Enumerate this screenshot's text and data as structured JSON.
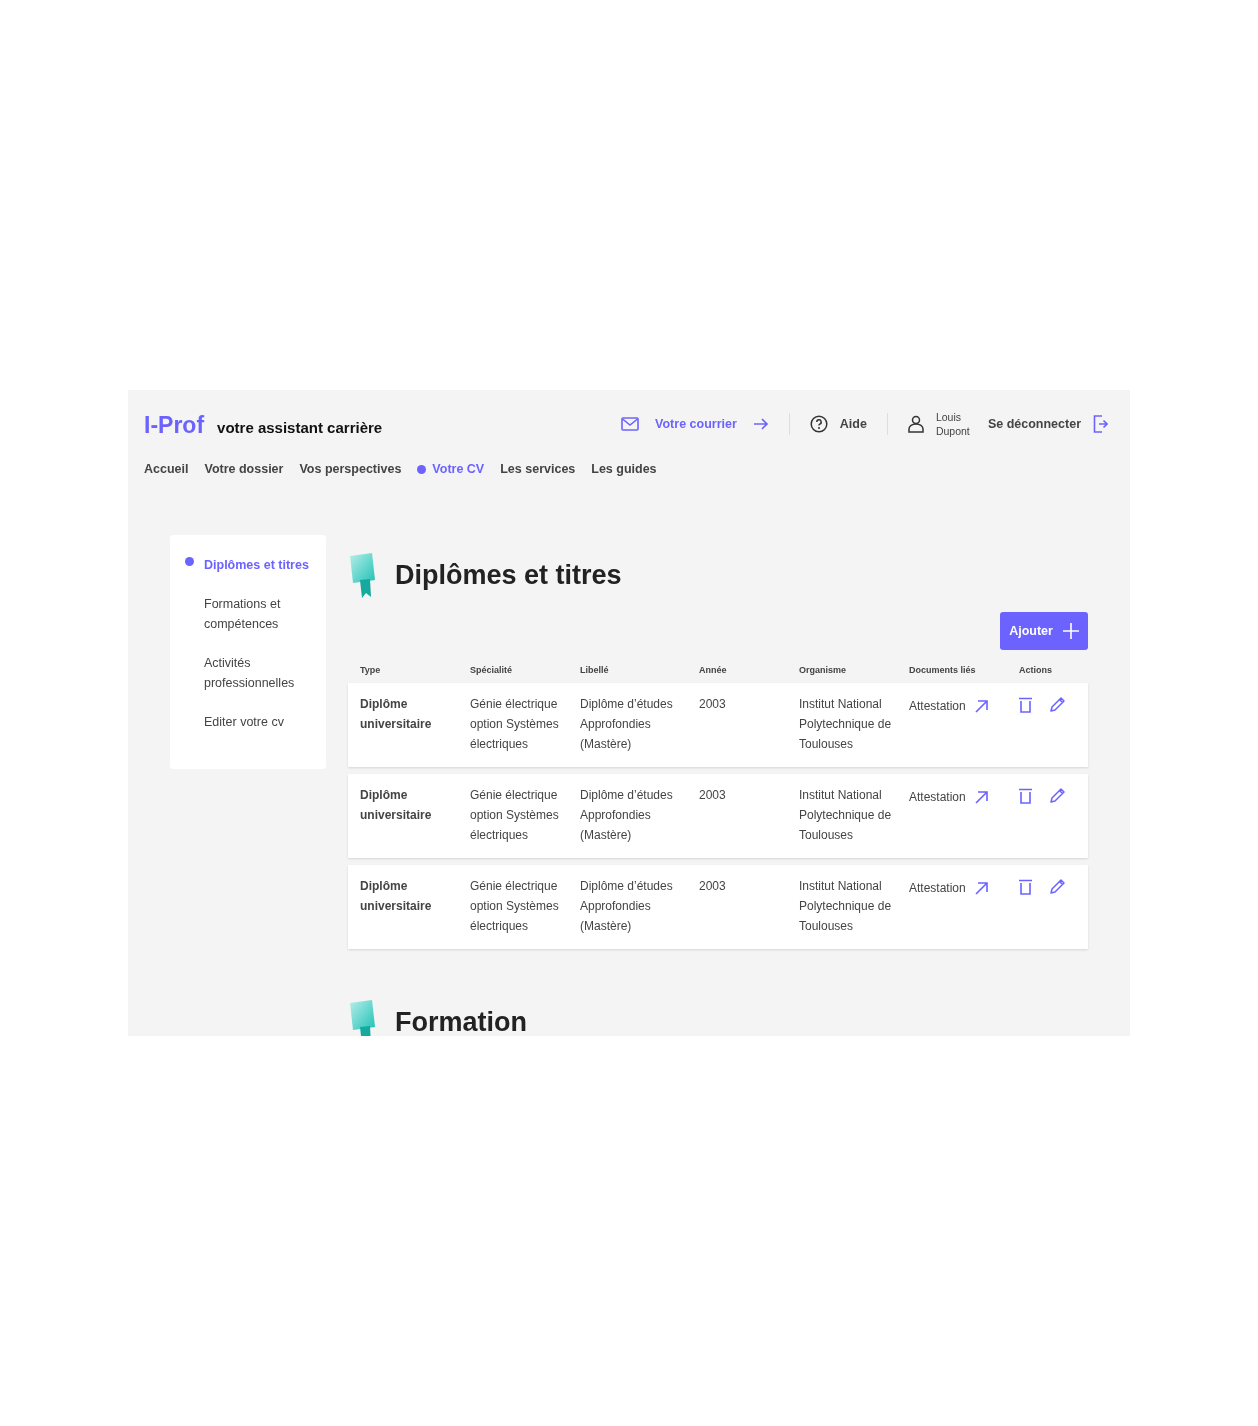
{
  "header": {
    "logo": "I-Prof",
    "tagline": "votre assistant carrière",
    "mail_link": "Votre courrier",
    "help": "Aide",
    "user": "Louis Dupont",
    "logout": "Se déconnecter"
  },
  "nav": [
    {
      "label": "Accueil",
      "selected": false
    },
    {
      "label": "Votre dossier",
      "selected": false
    },
    {
      "label": "Vos perspectives",
      "selected": false
    },
    {
      "label": "Votre CV",
      "selected": true
    },
    {
      "label": "Les services",
      "selected": false
    },
    {
      "label": "Les guides",
      "selected": false
    }
  ],
  "sidebar": {
    "items": [
      {
        "label": "Diplômes et titres",
        "selected": true
      },
      {
        "label": "Formations et compétences",
        "selected": false
      },
      {
        "label": "Activités professionnelles",
        "selected": false
      },
      {
        "label": "Editer votre cv",
        "selected": false
      }
    ]
  },
  "section": {
    "title": "Diplômes et titres",
    "add_button": "Ajouter",
    "table": {
      "columns": [
        "Type",
        "Spécialité",
        "Libellé",
        "Année",
        "Organisme",
        "Documents liés",
        "Actions"
      ],
      "rows": [
        {
          "type": "Diplôme universitaire",
          "specialty": "Génie électrique option Systèmes électriques",
          "label": "Diplôme d’études Approfondies (Mastère)",
          "year": "2003",
          "organism": "Institut National Polytechnique de Toulouses",
          "document": "Attestation"
        },
        {
          "type": "Diplôme universitaire",
          "specialty": "Génie électrique option Systèmes électriques",
          "label": "Diplôme d’études Approfondies (Mastère)",
          "year": "2003",
          "organism": "Institut National Polytechnique de Toulouses",
          "document": "Attestation"
        },
        {
          "type": "Diplôme universitaire",
          "specialty": "Génie électrique option Systèmes électriques",
          "label": "Diplôme d’études Approfondies (Mastère)",
          "year": "2003",
          "organism": "Institut National Polytechnique de Toulouses",
          "document": "Attestation"
        }
      ]
    }
  },
  "next_section": {
    "title": "Formation"
  }
}
